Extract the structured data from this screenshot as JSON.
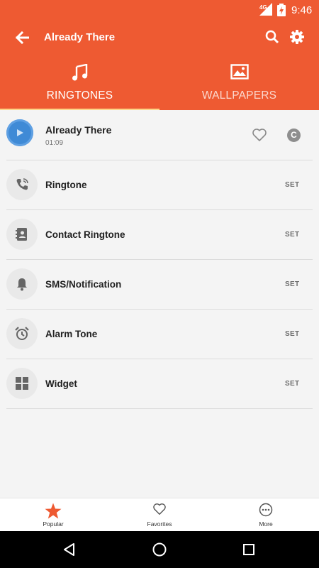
{
  "status_bar": {
    "network": "4G",
    "time": "9:46"
  },
  "header": {
    "title": "Already There"
  },
  "tabs": [
    {
      "label": "RINGTONES",
      "icon": "music-note-icon",
      "active": true
    },
    {
      "label": "WALLPAPERS",
      "icon": "image-icon",
      "active": false
    }
  ],
  "now_playing": {
    "title": "Already There",
    "duration": "01:09",
    "badge": "C"
  },
  "options": [
    {
      "label": "Ringtone",
      "icon": "phone-ringing-icon",
      "action": "SET"
    },
    {
      "label": "Contact Ringtone",
      "icon": "contact-icon",
      "action": "SET"
    },
    {
      "label": "SMS/Notification",
      "icon": "bell-icon",
      "action": "SET"
    },
    {
      "label": "Alarm Tone",
      "icon": "alarm-clock-icon",
      "action": "SET"
    },
    {
      "label": "Widget",
      "icon": "widget-grid-icon",
      "action": "SET"
    }
  ],
  "bottom_nav": [
    {
      "label": "Popular",
      "icon": "star-icon",
      "active": true
    },
    {
      "label": "Favorites",
      "icon": "heart-outline-icon",
      "active": false
    },
    {
      "label": "More",
      "icon": "more-dots-icon",
      "active": false
    }
  ],
  "colors": {
    "accent": "#ee5a32",
    "tab_indicator": "#fdd68a",
    "play_button": "#3f8ad6"
  }
}
